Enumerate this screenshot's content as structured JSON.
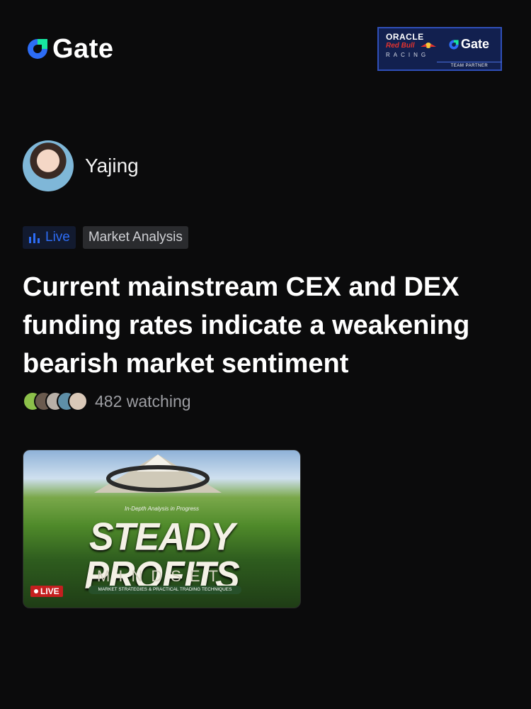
{
  "brand": {
    "name": "Gate",
    "logo_icon": "gate-logo-icon",
    "accent": "#2d6df6"
  },
  "partner_banner": {
    "line1": "ORACLE",
    "line2": "Red Bull",
    "line3": "RACING",
    "partner_name": "Gate",
    "caption": "TEAM PARTNER"
  },
  "host": {
    "name": "Yajing",
    "avatar_icon": "host-avatar"
  },
  "tags": {
    "live_label": "Live",
    "live_icon": "bar-chart-icon",
    "category": "Market Analysis"
  },
  "title": "Current mainstream CEX and DEX funding rates indicate a weakening bearish market sentiment",
  "watchers": {
    "count_text": "482 watching",
    "avatar_colors": [
      "#8cc04a",
      "#6a5a4e",
      "#b8b0a8",
      "#5e8fa8",
      "#d9c8b8"
    ]
  },
  "thumbnail": {
    "caption": "In-Depth Analysis in Progress",
    "headline": "STEADY PROFITS",
    "subheadline": "MINDSET",
    "strip": "MARKET STRATEGIES & PRACTICAL TRADING TECHNIQUES",
    "live_badge": "LIVE"
  }
}
